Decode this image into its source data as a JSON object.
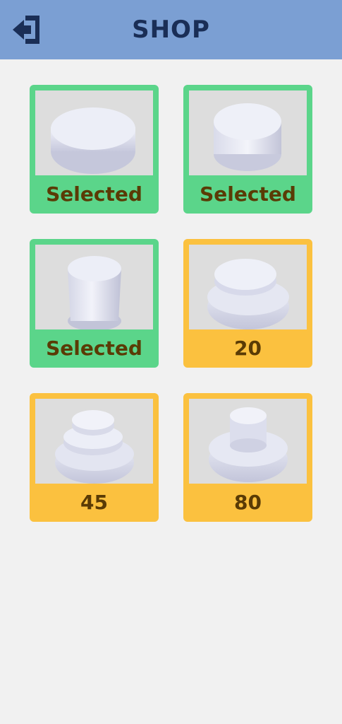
{
  "header": {
    "title": "SHOP",
    "back_icon": "exit-door-icon"
  },
  "items": [
    {
      "label": "Selected",
      "status": "selected",
      "shape": "round-disc"
    },
    {
      "label": "Selected",
      "status": "selected",
      "shape": "tall-disc"
    },
    {
      "label": "Selected",
      "status": "selected",
      "shape": "cylinder"
    },
    {
      "label": "20",
      "status": "price",
      "shape": "two-tier-disc"
    },
    {
      "label": "45",
      "status": "price",
      "shape": "three-tier-stack"
    },
    {
      "label": "80",
      "status": "price",
      "shape": "knob-on-disc"
    }
  ],
  "colors": {
    "header_bg": "#7b9fd3",
    "title": "#1a2e56",
    "selected": "#5bd58a",
    "price": "#fbc13f",
    "label_text": "#5a3b05",
    "page_bg": "#f1f1f1"
  }
}
